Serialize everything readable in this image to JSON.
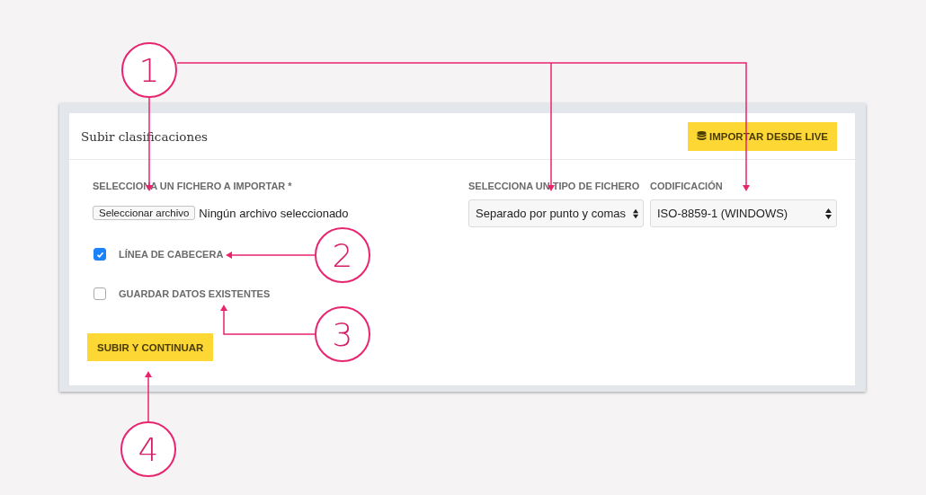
{
  "panel": {
    "title": "Subir clasificaciones",
    "import_button": "IMPORTAR DESDE LIVE",
    "file_field": {
      "label": "SELECCIONA UN FICHERO A IMPORTAR *",
      "button": "Seleccionar archivo",
      "status": "Ningún archivo seleccionado"
    },
    "options": [
      {
        "label": "LÍNEA DE CABECERA",
        "checked": true
      },
      {
        "label": "GUARDAR DATOS EXISTENTES",
        "checked": false
      }
    ],
    "submit_button": "SUBIR Y CONTINUAR",
    "selects": [
      {
        "label": "SELECCIONA UN TIPO DE FICHERO",
        "value": "Separado por punto y comas"
      },
      {
        "label": "CODIFICACIÓN",
        "value": "ISO-8859-1 (WINDOWS)"
      }
    ]
  },
  "callouts": [
    "1",
    "2",
    "3",
    "4"
  ]
}
